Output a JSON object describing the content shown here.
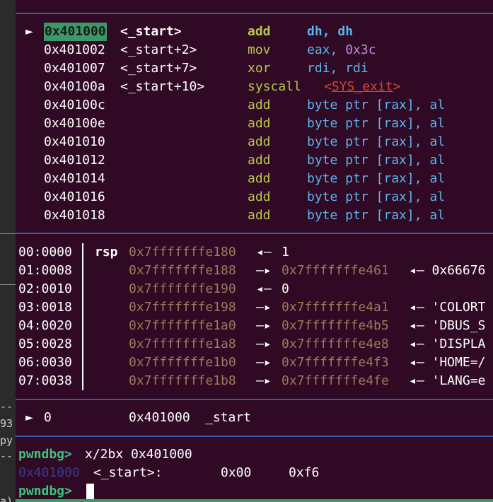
{
  "gutter_lines": [
    "--",
    "93",
    "py",
    "--",
    "a)"
  ],
  "disasm": [
    {
      "arrow": "►",
      "addr": "0x401000",
      "sym": "<_start>",
      "mnem": "add",
      "ops": [
        {
          "t": "dh, dh",
          "c": "op"
        }
      ],
      "current": true
    },
    {
      "arrow": "",
      "addr": "0x401002",
      "sym": "<_start+2>",
      "mnem": "mov",
      "ops": [
        {
          "t": "eax, ",
          "c": "op"
        },
        {
          "t": "0x3c",
          "c": "hex"
        }
      ]
    },
    {
      "arrow": "",
      "addr": "0x401007",
      "sym": "<_start+7>",
      "mnem": "xor",
      "ops": [
        {
          "t": "rdi, rdi",
          "c": "op"
        }
      ]
    },
    {
      "arrow": "",
      "addr": "0x40100a",
      "sym": "<_start+10>",
      "mnem": "syscall",
      "ops": [
        {
          "t": "<",
          "c": "ref"
        },
        {
          "t": "SYS_exit",
          "c": "refu"
        },
        {
          "t": ">",
          "c": "ref"
        }
      ]
    },
    {
      "arrow": "",
      "addr": "0x40100c",
      "sym": "",
      "mnem": "add",
      "ops": [
        {
          "t": "byte ptr [rax], al",
          "c": "op"
        }
      ]
    },
    {
      "arrow": "",
      "addr": "0x40100e",
      "sym": "",
      "mnem": "add",
      "ops": [
        {
          "t": "byte ptr [rax], al",
          "c": "op"
        }
      ]
    },
    {
      "arrow": "",
      "addr": "0x401010",
      "sym": "",
      "mnem": "add",
      "ops": [
        {
          "t": "byte ptr [rax], al",
          "c": "op"
        }
      ]
    },
    {
      "arrow": "",
      "addr": "0x401012",
      "sym": "",
      "mnem": "add",
      "ops": [
        {
          "t": "byte ptr [rax], al",
          "c": "op"
        }
      ]
    },
    {
      "arrow": "",
      "addr": "0x401014",
      "sym": "",
      "mnem": "add",
      "ops": [
        {
          "t": "byte ptr [rax], al",
          "c": "op"
        }
      ]
    },
    {
      "arrow": "",
      "addr": "0x401016",
      "sym": "",
      "mnem": "add",
      "ops": [
        {
          "t": "byte ptr [rax], al",
          "c": "op"
        }
      ]
    },
    {
      "arrow": "",
      "addr": "0x401018",
      "sym": "",
      "mnem": "add",
      "ops": [
        {
          "t": "byte ptr [rax], al",
          "c": "op"
        }
      ]
    }
  ],
  "stack": [
    {
      "idx": "00:0000",
      "reg": "rsp",
      "addr": "0x7fffffffe180",
      "arrow": "◂—",
      "ptr": "",
      "val": "1"
    },
    {
      "idx": "01:0008",
      "reg": "",
      "addr": "0x7fffffffe188",
      "arrow": "—▸",
      "ptr": "0x7fffffffe461",
      "val": "◂— 0x66676"
    },
    {
      "idx": "02:0010",
      "reg": "",
      "addr": "0x7fffffffe190",
      "arrow": "◂—",
      "ptr": "",
      "val": "0"
    },
    {
      "idx": "03:0018",
      "reg": "",
      "addr": "0x7fffffffe198",
      "arrow": "—▸",
      "ptr": "0x7fffffffe4a1",
      "val": "◂— 'COLORT"
    },
    {
      "idx": "04:0020",
      "reg": "",
      "addr": "0x7fffffffe1a0",
      "arrow": "—▸",
      "ptr": "0x7fffffffe4b5",
      "val": "◂— 'DBUS_S"
    },
    {
      "idx": "05:0028",
      "reg": "",
      "addr": "0x7fffffffe1a8",
      "arrow": "—▸",
      "ptr": "0x7fffffffe4e8",
      "val": "◂— 'DISPLA"
    },
    {
      "idx": "06:0030",
      "reg": "",
      "addr": "0x7fffffffe1b0",
      "arrow": "—▸",
      "ptr": "0x7fffffffe4f3",
      "val": "◂— 'HOME=/"
    },
    {
      "idx": "07:0038",
      "reg": "",
      "addr": "0x7fffffffe1b8",
      "arrow": "—▸",
      "ptr": "0x7fffffffe4fe",
      "val": "◂— 'LANG=e"
    }
  ],
  "backtrace": {
    "arrow": "►",
    "frame": "0",
    "addr": "0x401000",
    "sym": "_start"
  },
  "console": {
    "prompt": "pwndbg>",
    "command": "x/2bx 0x401000",
    "out_addr": "0x401000",
    "out_sym": "<_start>:",
    "out_b1": "0x00",
    "out_b2": "0xf6"
  },
  "colors": {
    "background": "#300a24",
    "separator": "#2f5fa8",
    "prompt": "#3cc47a",
    "mnemonic": "#b8c64a",
    "operand": "#5ab4ee"
  }
}
